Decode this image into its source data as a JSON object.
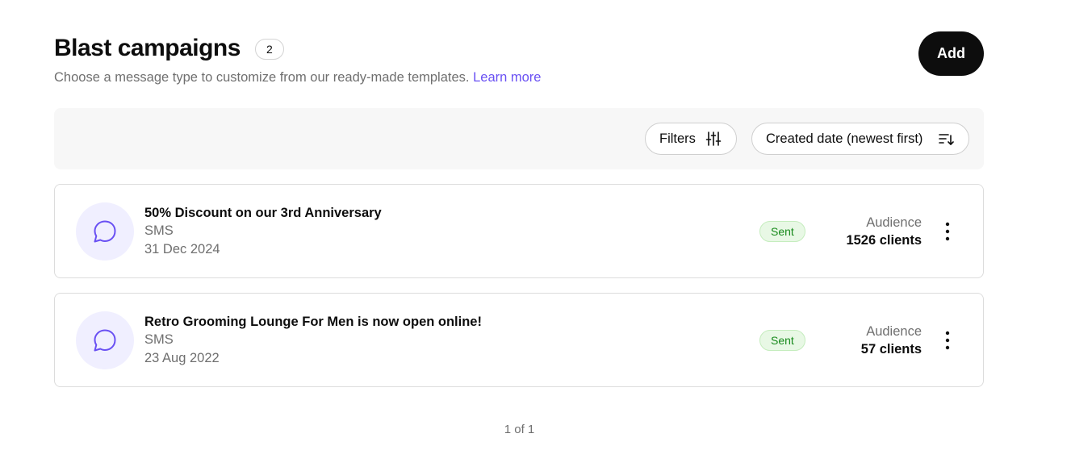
{
  "header": {
    "title": "Blast campaigns",
    "count": "2",
    "subtitle": "Choose a message type to customize from our ready-made templates.",
    "learn_more": "Learn more",
    "add_label": "Add"
  },
  "toolbar": {
    "filters_label": "Filters",
    "filters_icon": "sliders-icon",
    "sort_label": "Created date (newest first)",
    "sort_icon": "sort-descending-icon"
  },
  "campaigns": [
    {
      "title": "50% Discount on our 3rd Anniversary",
      "type": "SMS",
      "date": "31 Dec 2024",
      "status": "Sent",
      "audience_label": "Audience",
      "audience_value": "1526 clients",
      "icon": "message-bubble-icon"
    },
    {
      "title": "Retro Grooming Lounge For Men is now open online!",
      "type": "SMS",
      "date": "23 Aug 2022",
      "status": "Sent",
      "audience_label": "Audience",
      "audience_value": "57 clients",
      "icon": "message-bubble-icon"
    }
  ],
  "pagination": "1 of 1",
  "colors": {
    "accent": "#6950f3",
    "primary_button": "#0d0d0d",
    "status_sent_bg": "#e8f8e5",
    "status_sent_text": "#188a1c",
    "avatar_bg": "#f0efff",
    "muted_text": "#6f6f6f"
  }
}
